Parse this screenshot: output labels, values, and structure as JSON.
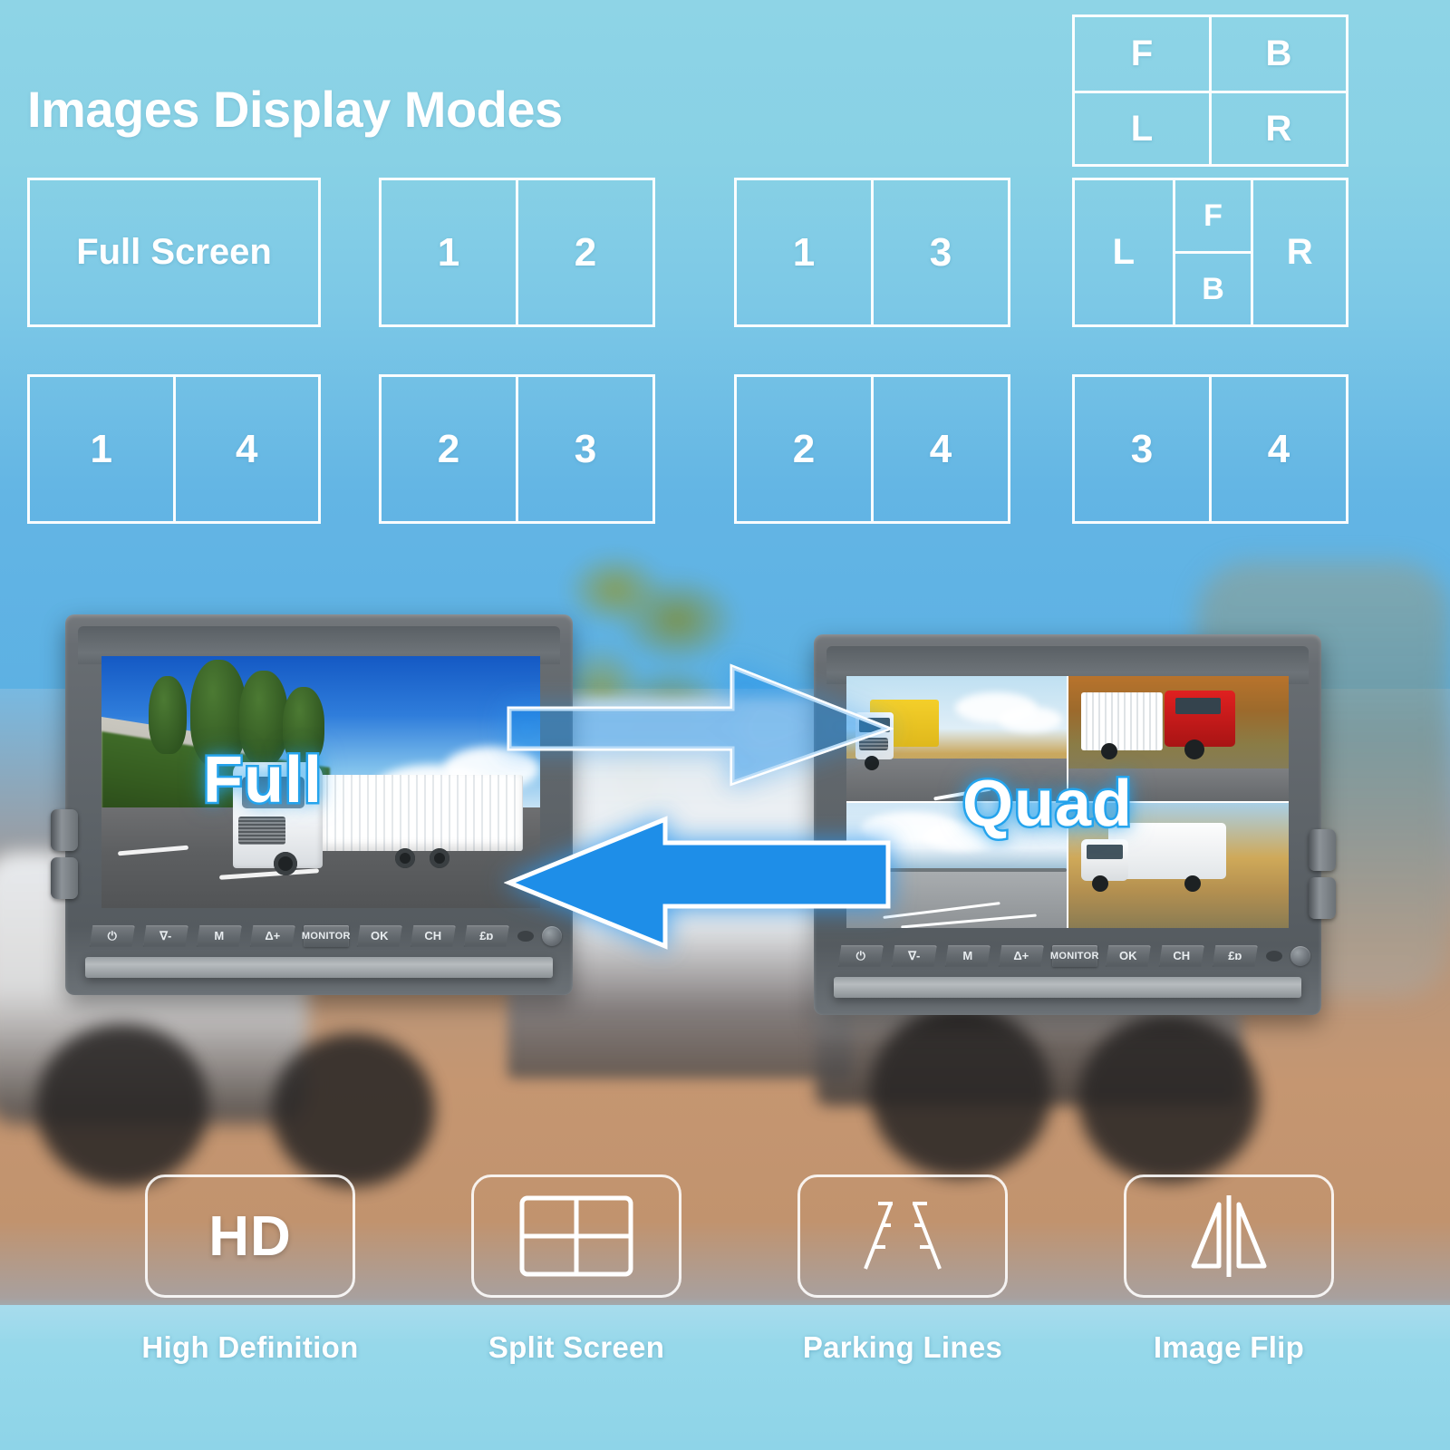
{
  "title": "Images Display Modes",
  "colors": {
    "sky_top": "#8ed4e6",
    "sky_bottom": "#5cb0e3",
    "ground": "#c5966f",
    "bottom_band": "#8ed4e8",
    "arrow_blue": "#1e8ee8",
    "text_white": "#ffffff",
    "word_outline": "#29a8ef"
  },
  "display_modes": {
    "full_screen_label": "Full Screen",
    "row1": [
      {
        "name": "full-screen",
        "type": "label",
        "cells": [
          "Full Screen"
        ]
      },
      {
        "name": "split-1-2",
        "type": "split2",
        "cells": [
          "1",
          "2"
        ]
      },
      {
        "name": "split-1-3",
        "type": "split2",
        "cells": [
          "1",
          "3"
        ]
      }
    ],
    "row2": [
      {
        "name": "split-1-4",
        "type": "split2",
        "cells": [
          "1",
          "4"
        ]
      },
      {
        "name": "split-2-3",
        "type": "split2",
        "cells": [
          "2",
          "3"
        ]
      },
      {
        "name": "split-2-4",
        "type": "split2",
        "cells": [
          "2",
          "4"
        ]
      },
      {
        "name": "split-3-4",
        "type": "split2",
        "cells": [
          "3",
          "4"
        ]
      }
    ],
    "quad_grid": {
      "name": "quad-fblr",
      "type": "grid4",
      "cells": [
        "F",
        "B",
        "L",
        "R"
      ]
    },
    "pip_grid": {
      "name": "pip-lfbr",
      "type": "lfbr",
      "left": "L",
      "mid_top": "F",
      "mid_bottom": "B",
      "right": "R"
    }
  },
  "monitors": {
    "left": {
      "screen_word": "Full",
      "mode": "Full Screen",
      "buttons": [
        {
          "name": "power-button",
          "label": "⏻"
        },
        {
          "name": "volume-down-button",
          "label": "∇-"
        },
        {
          "name": "menu-button",
          "label": "M"
        },
        {
          "name": "volume-up-button",
          "label": "Δ+"
        },
        {
          "name": "monitor-button",
          "label": "MONITOR"
        },
        {
          "name": "ok-button",
          "label": "OK"
        },
        {
          "name": "channel-button",
          "label": "CH"
        },
        {
          "name": "mute-button",
          "label": "£ɒ"
        }
      ]
    },
    "right": {
      "screen_word": "Quad",
      "mode": "Quad Split",
      "quad_feeds": [
        {
          "name": "feed-front-yellow-truck",
          "label": ""
        },
        {
          "name": "feed-rear-red-truck",
          "label": ""
        },
        {
          "name": "feed-left-bridge-highway",
          "label": ""
        },
        {
          "name": "feed-right-rv-motorhome",
          "label": ""
        }
      ],
      "buttons": [
        {
          "name": "power-button",
          "label": "⏻"
        },
        {
          "name": "volume-down-button",
          "label": "∇-"
        },
        {
          "name": "menu-button",
          "label": "M"
        },
        {
          "name": "volume-up-button",
          "label": "Δ+"
        },
        {
          "name": "monitor-button",
          "label": "MONITOR"
        },
        {
          "name": "ok-button",
          "label": "OK"
        },
        {
          "name": "channel-button",
          "label": "CH"
        },
        {
          "name": "mute-button",
          "label": "£ɒ"
        }
      ]
    }
  },
  "features": [
    {
      "name": "high-definition",
      "badge": "HD",
      "icon": "hd-text-icon",
      "label": "High Definition"
    },
    {
      "name": "split-screen",
      "badge": "",
      "icon": "quad-grid-icon",
      "label": "Split Screen"
    },
    {
      "name": "parking-lines",
      "badge": "",
      "icon": "parking-lines-icon",
      "label": "Parking Lines"
    },
    {
      "name": "image-flip",
      "badge": "",
      "icon": "mirror-flip-icon",
      "label": "Image Flip"
    }
  ]
}
